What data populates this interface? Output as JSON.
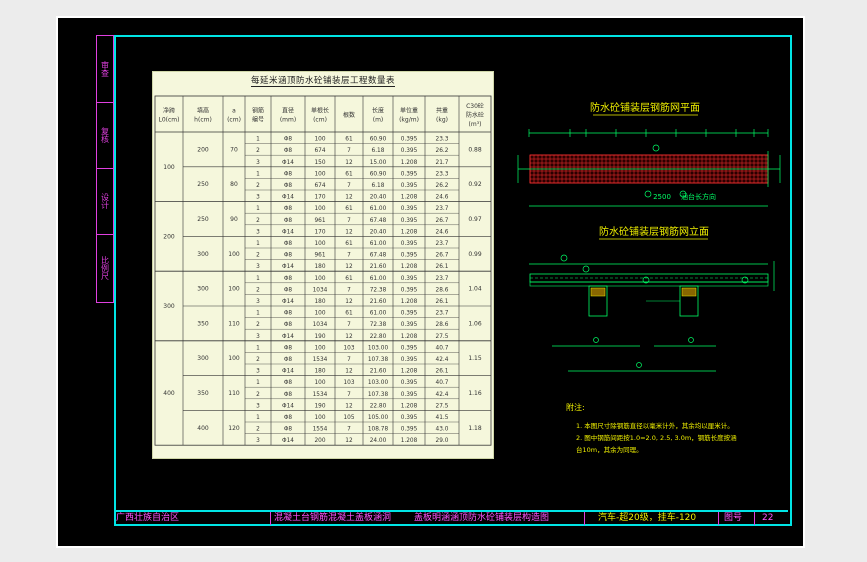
{
  "side_strip": [
    "审查",
    "复核",
    "设计",
    "比例尺"
  ],
  "table": {
    "title": "每延米涵顶防水砼铺装层工程数量表",
    "headers": [
      "净跨\nL0(cm)",
      "填高\nh(cm)",
      "a\n(cm)",
      "钢筋\n编号",
      "直径\n(mm)",
      "单根长\n(cm)",
      "根数",
      "长度\n(m)",
      "单位重\n(kg/m)",
      "共重\n(kg)",
      "C30砼\n防水砼\n(m³)"
    ],
    "groups": [
      {
        "span": "100",
        "subs": [
          {
            "h": "200",
            "a": "70",
            "concrete": "0.88",
            "rows": [
              [
                "1",
                "Φ8",
                "100",
                "61",
                "60.90",
                "0.395",
                "23.3"
              ],
              [
                "2",
                "Φ8",
                "674",
                "7",
                "6.18",
                "0.395",
                "26.2"
              ],
              [
                "3",
                "Φ14",
                "150",
                "12",
                "15.00",
                "1.208",
                "21.7"
              ]
            ]
          },
          {
            "h": "250",
            "a": "80",
            "concrete": "0.92",
            "rows": [
              [
                "1",
                "Φ8",
                "100",
                "61",
                "60.90",
                "0.395",
                "23.3"
              ],
              [
                "2",
                "Φ8",
                "674",
                "7",
                "6.18",
                "0.395",
                "26.2"
              ],
              [
                "3",
                "Φ14",
                "170",
                "12",
                "20.40",
                "1.208",
                "24.6"
              ]
            ]
          }
        ]
      },
      {
        "span": "200",
        "subs": [
          {
            "h": "250",
            "a": "90",
            "concrete": "0.97",
            "rows": [
              [
                "1",
                "Φ8",
                "100",
                "61",
                "61.00",
                "0.395",
                "23.7"
              ],
              [
                "2",
                "Φ8",
                "961",
                "7",
                "67.48",
                "0.395",
                "26.7"
              ],
              [
                "3",
                "Φ14",
                "170",
                "12",
                "20.40",
                "1.208",
                "24.6"
              ]
            ]
          },
          {
            "h": "300",
            "a": "100",
            "concrete": "0.99",
            "rows": [
              [
                "1",
                "Φ8",
                "100",
                "61",
                "61.00",
                "0.395",
                "23.7"
              ],
              [
                "2",
                "Φ8",
                "961",
                "7",
                "67.48",
                "0.395",
                "26.7"
              ],
              [
                "3",
                "Φ14",
                "180",
                "12",
                "21.60",
                "1.208",
                "26.1"
              ]
            ]
          }
        ]
      },
      {
        "span": "300",
        "subs": [
          {
            "h": "300",
            "a": "100",
            "concrete": "1.04",
            "rows": [
              [
                "1",
                "Φ8",
                "100",
                "61",
                "61.00",
                "0.395",
                "23.7"
              ],
              [
                "2",
                "Φ8",
                "1034",
                "7",
                "72.38",
                "0.395",
                "28.6"
              ],
              [
                "3",
                "Φ14",
                "180",
                "12",
                "21.60",
                "1.208",
                "26.1"
              ]
            ]
          },
          {
            "h": "350",
            "a": "110",
            "concrete": "1.06",
            "rows": [
              [
                "1",
                "Φ8",
                "100",
                "61",
                "61.00",
                "0.395",
                "23.7"
              ],
              [
                "2",
                "Φ8",
                "1034",
                "7",
                "72.38",
                "0.395",
                "28.6"
              ],
              [
                "3",
                "Φ14",
                "190",
                "12",
                "22.80",
                "1.208",
                "27.5"
              ]
            ]
          }
        ]
      },
      {
        "span": "400",
        "subs": [
          {
            "h": "300",
            "a": "100",
            "concrete": "1.15",
            "rows": [
              [
                "1",
                "Φ8",
                "100",
                "103",
                "103.00",
                "0.395",
                "40.7"
              ],
              [
                "2",
                "Φ8",
                "1534",
                "7",
                "107.38",
                "0.395",
                "42.4"
              ],
              [
                "3",
                "Φ14",
                "180",
                "12",
                "21.60",
                "1.208",
                "26.1"
              ]
            ]
          },
          {
            "h": "350",
            "a": "110",
            "concrete": "1.16",
            "rows": [
              [
                "1",
                "Φ8",
                "100",
                "103",
                "103.00",
                "0.395",
                "40.7"
              ],
              [
                "2",
                "Φ8",
                "1534",
                "7",
                "107.38",
                "0.395",
                "42.4"
              ],
              [
                "3",
                "Φ14",
                "190",
                "12",
                "22.80",
                "1.208",
                "27.5"
              ]
            ]
          },
          {
            "h": "400",
            "a": "120",
            "concrete": "1.18",
            "rows": [
              [
                "1",
                "Φ8",
                "100",
                "105",
                "105.00",
                "0.395",
                "41.5"
              ],
              [
                "2",
                "Φ8",
                "1554",
                "7",
                "108.78",
                "0.395",
                "43.0"
              ],
              [
                "3",
                "Φ14",
                "200",
                "12",
                "24.00",
                "1.208",
                "29.0"
              ]
            ]
          }
        ]
      }
    ]
  },
  "drawing": {
    "plan_title": "防水砼铺装层钢筋网平面",
    "elevation_title": "防水砼铺装层钢筋网立面",
    "plan_dim_label": "2500",
    "plan_length_label": "涵台长方向",
    "notes_title": "附注:",
    "notes": [
      "1. 本图尺寸除钢筋直径以毫米计外，其余均以厘米计。",
      "2. 图中钢筋间距按1.0=2.0, 2.5, 3.0m，钢筋长度按涵",
      "   台10m，其余为同理。"
    ]
  },
  "title_block": {
    "company": "广西壮族自治区",
    "series": "混凝土台钢筋混凝土盖板涵洞",
    "drawing_name": "盖板明涵涵顶防水砼铺装层构造图",
    "load": "汽车-超20级，挂车-120",
    "sheet_label": "图号",
    "sheet_number": "22"
  },
  "colors": {
    "background": "#000000",
    "frame": "#ffffff",
    "inner_frame": "#00e5e5",
    "side_strip": "#e040e0",
    "drawing_lines": "#00ff66",
    "rebar_mesh": "#ff3030",
    "table_panel": "#f5f7dc",
    "title_yellow": "#f0f000",
    "title_pink": "#ff55ff"
  }
}
